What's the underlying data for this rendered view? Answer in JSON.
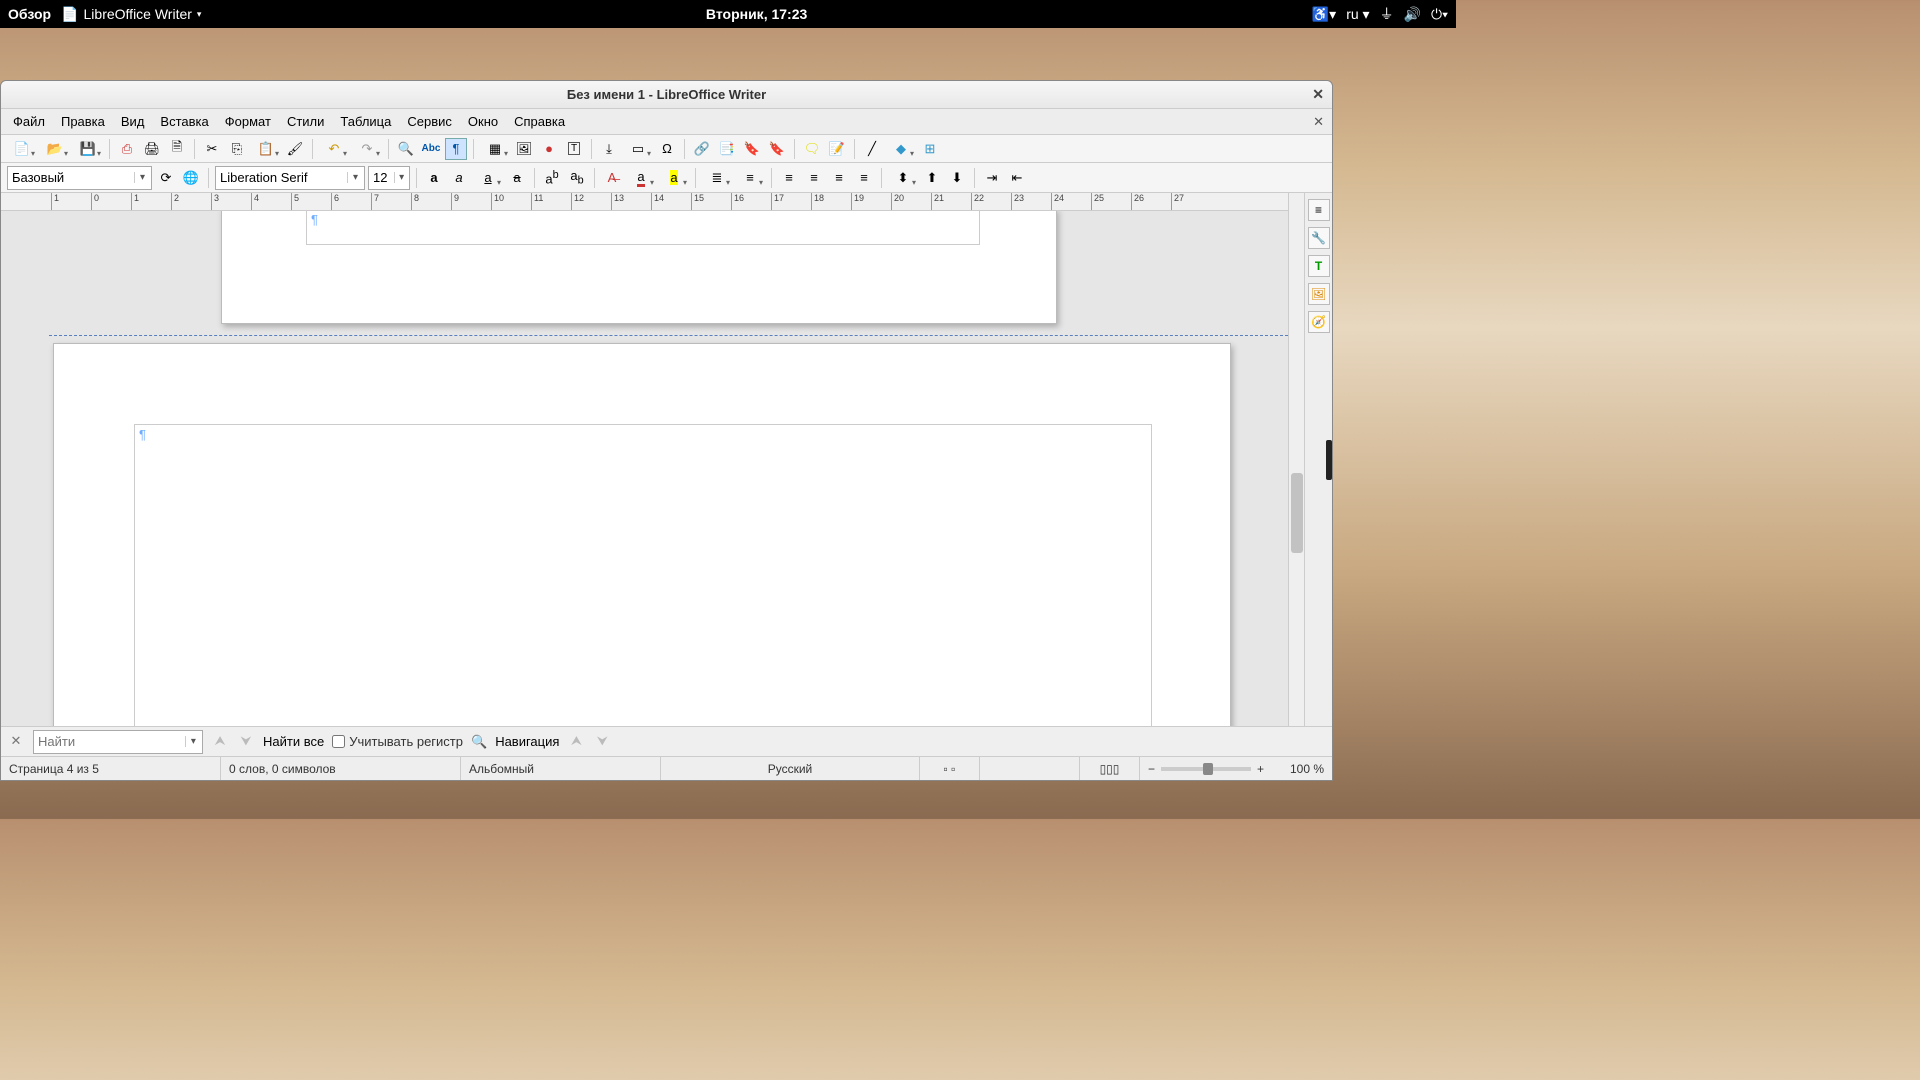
{
  "system": {
    "activities": "Обзор",
    "app_name": "LibreOffice Writer",
    "datetime": "Вторник, 17:23",
    "input_lang": "ru"
  },
  "window": {
    "title": "Без имени 1 - LibreOffice Writer"
  },
  "menu": [
    "Файл",
    "Правка",
    "Вид",
    "Вставка",
    "Формат",
    "Стили",
    "Таблица",
    "Сервис",
    "Окно",
    "Справка"
  ],
  "format": {
    "para_style": "Базовый",
    "font_name": "Liberation Serif",
    "font_size": "12"
  },
  "ruler": {
    "start": -1,
    "end": 27
  },
  "findbar": {
    "placeholder": "Найти",
    "find_all": "Найти все",
    "match_case": "Учитывать регистр",
    "navigation": "Навигация"
  },
  "status": {
    "page": "Страница 4 из 5",
    "words": "0 слов, 0 символов",
    "page_style": "Альбомный",
    "language": "Русский",
    "zoom": "100 %"
  }
}
